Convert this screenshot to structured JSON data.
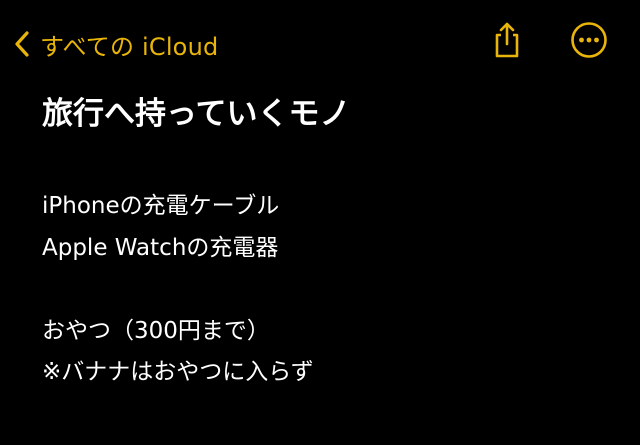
{
  "colors": {
    "accent": "#e9b50a",
    "background": "#000000",
    "text": "#ffffff"
  },
  "navbar": {
    "back_label": "すべての iCloud",
    "back_icon": "chevron-left-icon",
    "share_icon": "share-icon",
    "more_icon": "more-ellipsis-icon"
  },
  "note": {
    "title": "旅行へ持っていくモノ",
    "lines": [
      "iPhoneの充電ケーブル",
      "Apple Watchの充電器",
      "",
      "おやつ（300円まで）",
      "※バナナはおやつに入らず"
    ]
  }
}
